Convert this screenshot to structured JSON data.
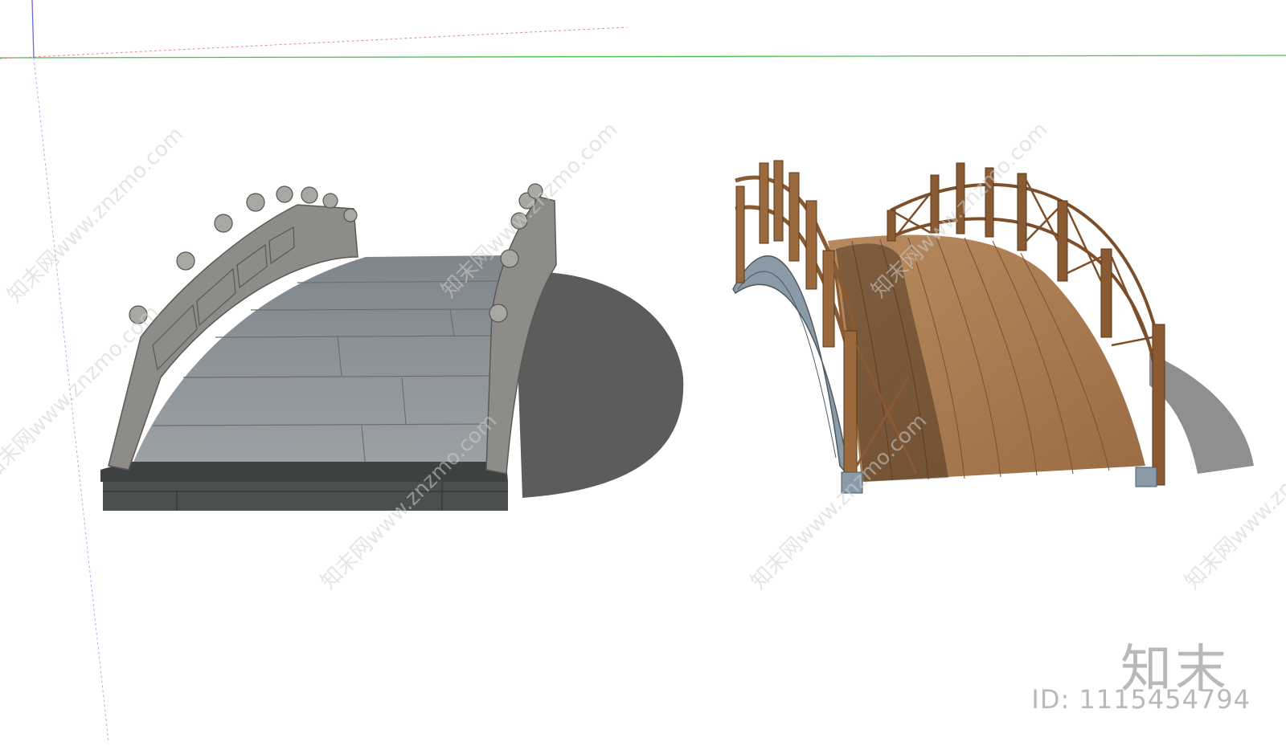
{
  "watermark": {
    "site_text": "知末网www.znzmo.com",
    "brand": "知末",
    "id_text": "ID: 1115454794"
  },
  "scene": {
    "objects": [
      "stone-arch-bridge",
      "wooden-arch-bridge"
    ],
    "colors": {
      "background": "#ffffff",
      "axis_green": "#4cc04c",
      "axis_blue": "#8f8fe0",
      "stone_deck": "#8d9296",
      "stone_rail": "#9a9894",
      "stone_base": "#4a4d4e",
      "wood_deck": "#a9794f",
      "wood_rail": "#8a5a32",
      "steel_arch": "#8a9aa6",
      "shadow": "#5e5e5e"
    }
  }
}
